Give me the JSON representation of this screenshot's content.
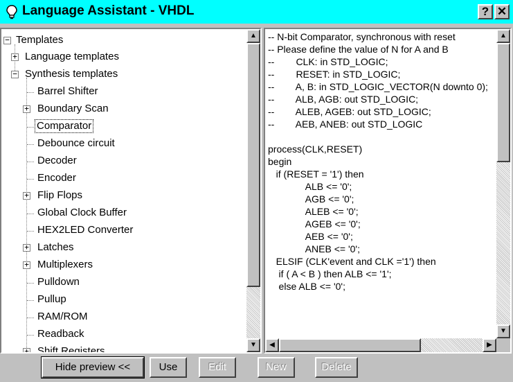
{
  "window": {
    "title": "Language Assistant - VHDL",
    "help_label": "?",
    "close_label": "✕"
  },
  "tree": {
    "items": [
      {
        "label": "Templates",
        "toggle": "−"
      },
      {
        "label": "Language templates",
        "toggle": "+"
      },
      {
        "label": "Synthesis templates",
        "toggle": "−"
      },
      {
        "label": "Barrel Shifter",
        "toggle": ""
      },
      {
        "label": "Boundary Scan",
        "toggle": "+"
      },
      {
        "label": "Comparator",
        "toggle": "",
        "selected": true
      },
      {
        "label": "Debounce circuit",
        "toggle": ""
      },
      {
        "label": "Decoder",
        "toggle": ""
      },
      {
        "label": "Encoder",
        "toggle": ""
      },
      {
        "label": "Flip Flops",
        "toggle": "+"
      },
      {
        "label": "Global Clock Buffer",
        "toggle": ""
      },
      {
        "label": "HEX2LED Converter",
        "toggle": ""
      },
      {
        "label": "Latches",
        "toggle": "+"
      },
      {
        "label": "Multiplexers",
        "toggle": "+"
      },
      {
        "label": "Pulldown",
        "toggle": ""
      },
      {
        "label": "Pullup",
        "toggle": ""
      },
      {
        "label": "RAM/ROM",
        "toggle": ""
      },
      {
        "label": "Readback",
        "toggle": ""
      },
      {
        "label": "Shift Registers",
        "toggle": "+"
      }
    ]
  },
  "preview": {
    "lines": [
      "-- N-bit Comparator, synchronous with reset",
      "-- Please define the value of N for A and B",
      "--        CLK: in STD_LOGIC;",
      "--        RESET: in STD_LOGIC;",
      "--        A, B: in STD_LOGIC_VECTOR(N downto 0);",
      "--        ALB, AGB: out STD_LOGIC;",
      "--        ALEB, AGEB: out STD_LOGIC;",
      "--        AEB, ANEB: out STD_LOGIC",
      "",
      "process(CLK,RESET)",
      "begin",
      "   if (RESET = '1') then",
      "              ALB <= '0';",
      "              AGB <= '0';",
      "              ALEB <= '0';",
      "              AGEB <= '0';",
      "              AEB <= '0';",
      "              ANEB <= '0';",
      "   ELSIF (CLK'event and CLK ='1') then",
      "    if ( A < B ) then ALB <= '1';",
      "    else ALB <= '0';"
    ]
  },
  "buttons": {
    "hide_preview": "Hide preview <<",
    "use": "Use",
    "edit": "Edit",
    "new": "New",
    "delete": "Delete"
  },
  "scroll": {
    "up_glyph": "▲",
    "down_glyph": "▼",
    "left_glyph": "◀",
    "right_glyph": "▶"
  }
}
